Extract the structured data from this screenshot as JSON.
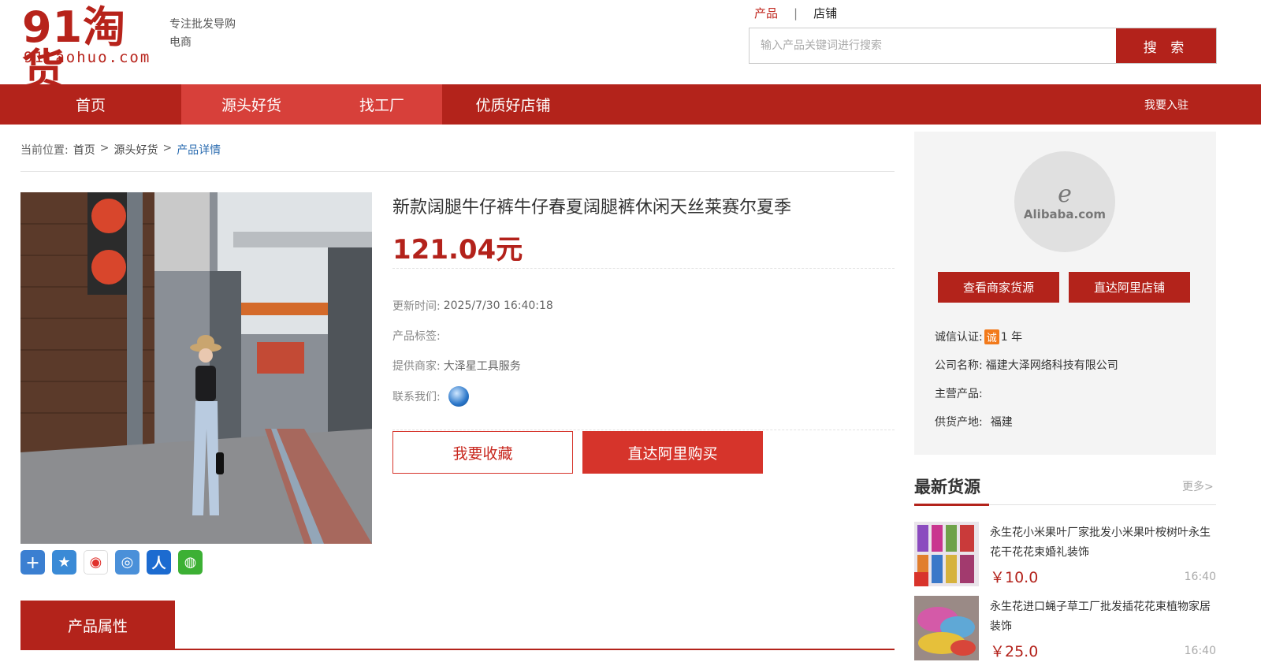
{
  "header": {
    "logo_cn": "91淘货",
    "logo_en": "91taohuo.com",
    "slogan_line1": "专注批发导购",
    "slogan_line2": "电商",
    "search_tab_product": "产品",
    "search_tab_sep": "|",
    "search_tab_shop": "店铺",
    "search_placeholder": "输入产品关键词进行搜索",
    "search_button": "搜 索"
  },
  "nav": {
    "items": [
      "首页",
      "源头好货",
      "找工厂",
      "优质好店铺"
    ],
    "join": "我要入驻"
  },
  "breadcrumb": {
    "label": "当前位置:",
    "home": "首页",
    "sep": ">",
    "category": "源头好货",
    "current": "产品详情"
  },
  "product": {
    "title": "新款阔腿牛仔裤牛仔春夏阔腿裤休闲天丝莱赛尔夏季",
    "price": "121.04元",
    "update_label": "更新时间:",
    "update_value": "2025/7/30 16:40:18",
    "tags_label": "产品标签:",
    "tags_value": "",
    "supplier_label": "提供商家:",
    "supplier_value": "大泽星工具服务",
    "contact_label": "联系我们:",
    "fav_button": "我要收藏",
    "buy_button": "直达阿里购买",
    "image_icon": "product-photo"
  },
  "share_icons": [
    "plus-share-icon",
    "star-share-icon",
    "weibo-icon",
    "tencent-weibo-icon",
    "renren-icon",
    "wechat-icon"
  ],
  "attributes_tab": "产品属性",
  "seller": {
    "logo_mark": "e",
    "logo_text": "Alibaba.com",
    "view_button": "查看商家货源",
    "shop_button": "直达阿里店铺",
    "credit_label": "诚信认证:",
    "credit_badge": "诚",
    "credit_value": "1 年",
    "company_label": "公司名称:",
    "company_value": "福建大泽网络科技有限公司",
    "main_label": "主营产品:",
    "main_value": "",
    "origin_label": "供货产地:",
    "origin_value": "福建"
  },
  "latest": {
    "title": "最新货源",
    "more": "更多>",
    "items": [
      {
        "name": "永生花小米果叶厂家批发小米果叶桉树叶永生花干花花束婚礼装饰",
        "price": "￥10.0",
        "time": "16:40"
      },
      {
        "name": "永生花进口蝇子草工厂批发插花花束植物家居装饰",
        "price": "￥25.0",
        "time": "16:40"
      }
    ]
  },
  "colors": {
    "brand_red": "#b3231b",
    "nav_active": "#d7403a",
    "price_red": "#b3221b",
    "link_blue": "#2b6cb0"
  }
}
